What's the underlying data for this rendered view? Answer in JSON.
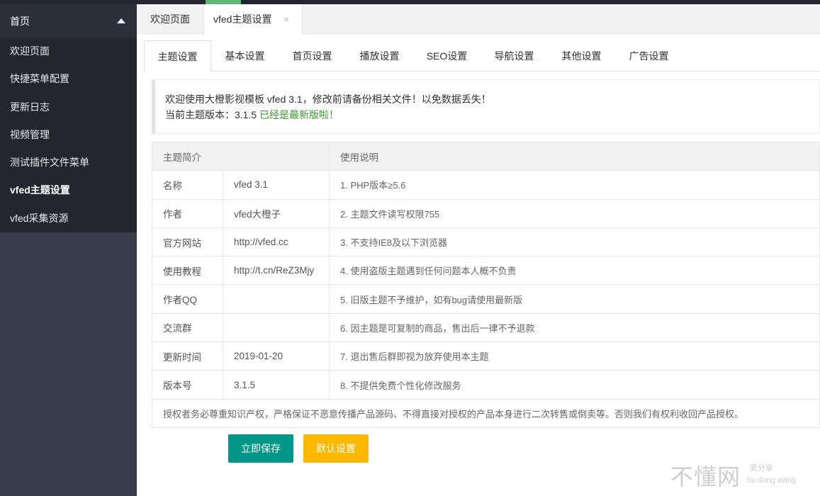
{
  "sidebar": {
    "home_label": "首页",
    "items": [
      {
        "label": "欢迎页面"
      },
      {
        "label": "快捷菜单配置"
      },
      {
        "label": "更新日志"
      },
      {
        "label": "视频管理"
      },
      {
        "label": "测试插件文件菜单"
      },
      {
        "label": "vfed主题设置"
      },
      {
        "label": "vfed采集资源"
      }
    ]
  },
  "tabs": [
    {
      "label": "欢迎页面"
    },
    {
      "label": "vfed主题设置",
      "close": "×"
    }
  ],
  "subtabs": [
    {
      "label": "主题设置"
    },
    {
      "label": "基本设置"
    },
    {
      "label": "首页设置"
    },
    {
      "label": "播放设置"
    },
    {
      "label": "SEO设置"
    },
    {
      "label": "导航设置"
    },
    {
      "label": "其他设置"
    },
    {
      "label": "广告设置"
    }
  ],
  "notice": {
    "line1": "欢迎使用大橙影视模板 vfed 3.1，修改前请备份相关文件！以免数据丢失！",
    "version_label": "当前主题版本：3.1.5",
    "status": "已经是最新版啦！"
  },
  "table": {
    "header_left": "主题简介",
    "header_right": "使用说明",
    "rows": [
      {
        "key": "名称",
        "value": "vfed 3.1",
        "note": "1. PHP版本≥5.6"
      },
      {
        "key": "作者",
        "value": "vfed大橙子",
        "note": "2. 主题文件读写权限755"
      },
      {
        "key": "官方网站",
        "value": "http://vfed.cc",
        "note": "3. 不支持IE8及以下浏览器"
      },
      {
        "key": "使用教程",
        "value": "http://t.cn/ReZ3Mjy",
        "note": "4. 使用盗版主题遇到任何问题本人概不负责"
      },
      {
        "key": "作者QQ",
        "value": "",
        "note": "5. 旧版主题不予维护，如有bug请使用最新版"
      },
      {
        "key": "交流群",
        "value": "",
        "note": "6. 因主题是可复制的商品，售出后一律不予退款"
      },
      {
        "key": "更新时间",
        "value": "2019-01-20",
        "note": "7. 退出售后群即视为放弃使用本主题"
      },
      {
        "key": "版本号",
        "value": "3.1.5",
        "note": "8. 不提供免费个性化修改服务"
      }
    ],
    "footer": "授权者务必尊重知识产权，严格保证不恶意传播产品源码、不得直接对授权的产品本身进行二次转售或倒卖等。否则我们有权利收回产品授权。"
  },
  "buttons": {
    "save": "立即保存",
    "default": "默认设置"
  },
  "watermark": {
    "main": "不懂网",
    "tag": "爱分享",
    "pinyin": "bu dong wang"
  },
  "colors": {
    "sidebar_bg": "#393d49",
    "accent_green": "#5FB878",
    "save_button": "#009688",
    "default_button": "#FFB800",
    "status_green": "#3a9b2f"
  }
}
